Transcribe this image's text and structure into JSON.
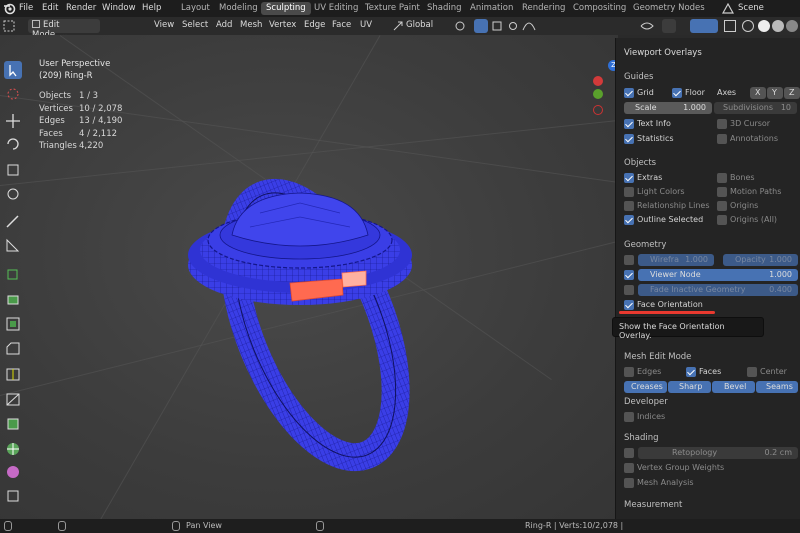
{
  "app": {
    "menus": [
      "File",
      "Edit",
      "Render",
      "Window",
      "Help"
    ],
    "tabs": [
      "Layout",
      "Modeling",
      "Sculpting",
      "UV Editing",
      "Texture Paint",
      "Shading",
      "Animation",
      "Rendering",
      "Compositing",
      "Geometry Nodes"
    ],
    "active_tab": "Sculpting",
    "scene": "Scene"
  },
  "header": {
    "mode": "Edit Mode",
    "menus": [
      "View",
      "Select",
      "Add",
      "Mesh",
      "Vertex",
      "Edge",
      "Face",
      "UV"
    ],
    "transform_orientation": "Global"
  },
  "viewport": {
    "perspective": "User Perspective",
    "object_name": "(209) Ring-R",
    "stats": [
      {
        "label": "Objects",
        "value": "1 / 3"
      },
      {
        "label": "Vertices",
        "value": "10 / 2,078"
      },
      {
        "label": "Edges",
        "value": "13 / 4,190"
      },
      {
        "label": "Faces",
        "value": "4 / 2,112"
      },
      {
        "label": "Triangles",
        "value": "4,220"
      }
    ],
    "gizmo_axis": "Z"
  },
  "overlays": {
    "title": "Viewport Overlays",
    "guides": {
      "heading": "Guides",
      "grid": "Grid",
      "floor": "Floor",
      "axes": "Axes",
      "axis_x": "X",
      "axis_y": "Y",
      "axis_z": "Z",
      "scale_label": "Scale",
      "scale_value": "1.000",
      "subdivisions_label": "Subdivisions",
      "subdivisions_value": "10",
      "text_info": "Text Info",
      "cursor_3d": "3D Cursor",
      "statistics": "Statistics",
      "annotations": "Annotations"
    },
    "objects": {
      "heading": "Objects",
      "extras": "Extras",
      "bones": "Bones",
      "light_colors": "Light Colors",
      "motion_paths": "Motion Paths",
      "relationship_lines": "Relationship Lines",
      "origins": "Origins",
      "outline_selected": "Outline Selected",
      "origins_all": "Origins (All)"
    },
    "geometry": {
      "heading": "Geometry",
      "wireframe_label": "Wirefra",
      "wireframe_value": "1.000",
      "opacity_label": "Opacity",
      "opacity_value": "1.000",
      "viewer_node_label": "Viewer Node",
      "viewer_node_value": "1.000",
      "fade_label": "Fade Inactive Geometry",
      "fade_value": "0.400",
      "face_orientation": "Face Orientation"
    },
    "tooltip": "Show the Face Orientation Overlay.",
    "mesh_edit": {
      "heading": "Mesh Edit Mode",
      "edges": "Edges",
      "faces": "Faces",
      "center": "Center",
      "creases": "Creases",
      "sharp": "Sharp",
      "bevel": "Bevel",
      "seams": "Seams"
    },
    "developer": {
      "heading": "Developer",
      "indices": "Indices"
    },
    "shading": {
      "heading": "Shading",
      "retopology_label": "Retopology",
      "retopology_value": "0.2 cm",
      "vertex_group_weights": "Vertex Group Weights",
      "mesh_analysis": "Mesh Analysis"
    },
    "measurement": {
      "heading": "Measurement"
    }
  },
  "status": {
    "action": "Pan View",
    "info": "Ring-R | Verts:10/2,078 |"
  },
  "colors": {
    "accent": "#4772b3",
    "ring_blue": "#3a3ee6",
    "selection_red": "#e8392f",
    "face_orange": "#ff6a50"
  }
}
